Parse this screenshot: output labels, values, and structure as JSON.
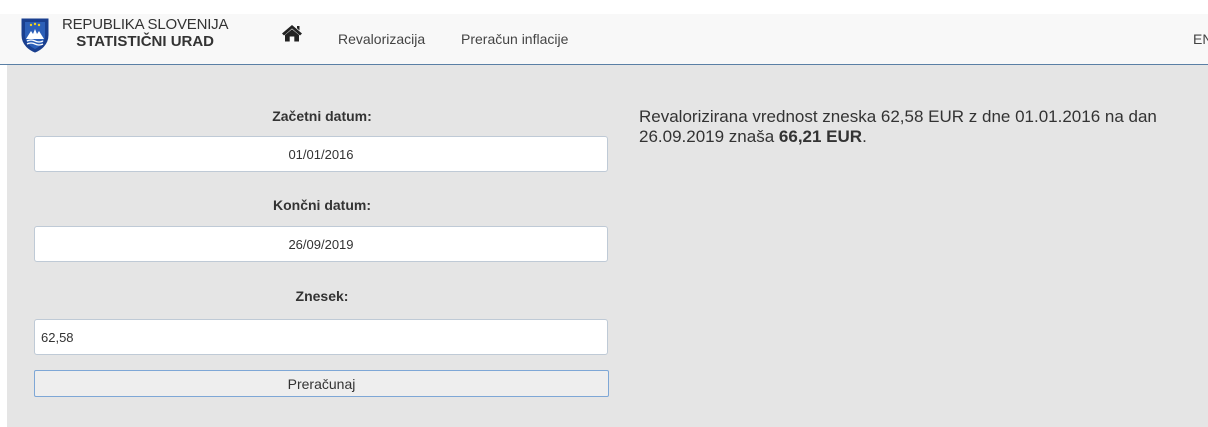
{
  "header": {
    "brand_line1": "REPUBLIKA SLOVENIJA",
    "brand_line2": "STATISTIČNI URAD",
    "nav": [
      "Revalorizacija",
      "Preračun inflacije"
    ],
    "lang": "EN",
    "logo_icon": "slovenia-coat-of-arms-icon",
    "home_icon": "home-icon"
  },
  "form": {
    "start_label": "Začetni datum:",
    "start_value": "01/01/2016",
    "end_label": "Končni datum:",
    "end_value": "26/09/2019",
    "amount_label": "Znesek:",
    "amount_value": "62,58",
    "submit_label": "Preračunaj"
  },
  "result": {
    "text_before": "Revalorizirana vrednost zneska 62,58 EUR z dne 01.01.2016 na dan 26.09.2019 znaša ",
    "amount": "66,21 EUR",
    "text_after": "."
  },
  "colors": {
    "panel_bg": "#e5e5e5",
    "header_border": "#5a7fa5",
    "button_border": "#7ea7d6"
  }
}
